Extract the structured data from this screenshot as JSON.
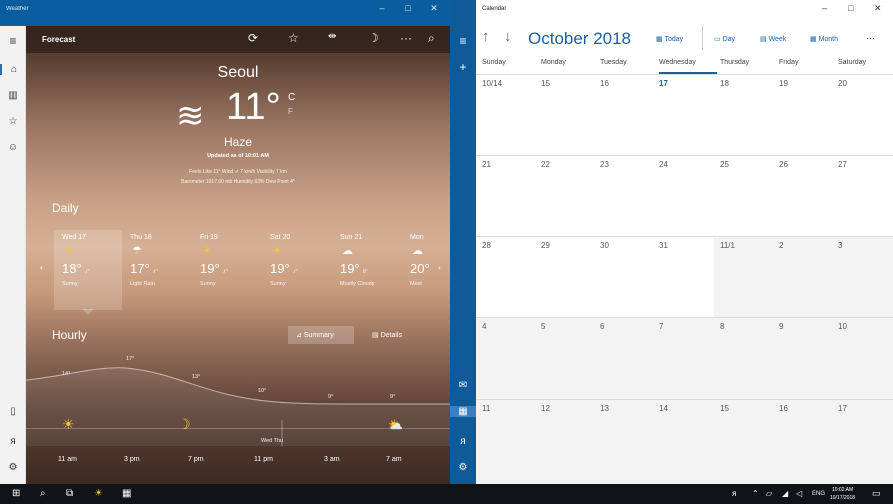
{
  "weather": {
    "window_title": "Weather",
    "topbar": {
      "title": "Forecast"
    },
    "city": "Seoul",
    "temperature": "11°",
    "unit_c": "C",
    "unit_f": "F",
    "condition": "Haze",
    "updated": "Updated as of 10:01 AM",
    "details_line1": "Feels Like 11°    Wind ➚ 7 km/h    Visibility 7 km",
    "details_line2": "Barometer 1017.00 mb    Humidity 63%    Dew Point 4°",
    "daily_label": "Daily",
    "days": [
      {
        "day": "Wed 17",
        "icon": "sun",
        "hi": "18°",
        "lo": "7°",
        "cond": "Sunny"
      },
      {
        "day": "Thu 18",
        "icon": "rain",
        "hi": "17°",
        "lo": "7°",
        "cond": "Light Rain"
      },
      {
        "day": "Fri 19",
        "icon": "sun",
        "hi": "19°",
        "lo": "7°",
        "cond": "Sunny"
      },
      {
        "day": "Sat 20",
        "icon": "sun",
        "hi": "19°",
        "lo": "7°",
        "cond": "Sunny"
      },
      {
        "day": "Sun 21",
        "icon": "cloud",
        "hi": "19°",
        "lo": "8°",
        "cond": "Mostly Cloudy"
      },
      {
        "day": "Mon",
        "icon": "cloud",
        "hi": "20°",
        "lo": "",
        "cond": "Most"
      }
    ],
    "hourly_label": "Hourly",
    "summary_label": "Summary",
    "details_label": "Details",
    "hourly_temps": [
      "14°",
      "17°",
      "13°",
      "10°",
      "9°",
      "9°"
    ],
    "hourly_times": [
      "11 am",
      "3 pm",
      "7 pm",
      "11 pm",
      "3 am",
      "7 am"
    ],
    "day_divider": "Wed   Thu"
  },
  "calendar": {
    "window_title": "Calendar",
    "month_title": "October 2018",
    "today_label": "Today",
    "day_label": "Day",
    "week_label": "Week",
    "month_label": "Month",
    "more_label": "···",
    "day_headers": [
      "Sunday",
      "Monday",
      "Tuesday",
      "Wednesday",
      "Thursday",
      "Friday",
      "Saturday"
    ],
    "weeks": [
      [
        "10/14",
        "15",
        "16",
        "17",
        "18",
        "19",
        "20"
      ],
      [
        "21",
        "22",
        "23",
        "24",
        "25",
        "26",
        "27"
      ],
      [
        "28",
        "29",
        "30",
        "31",
        "11/1",
        "2",
        "3"
      ],
      [
        "4",
        "5",
        "6",
        "7",
        "8",
        "9",
        "10"
      ],
      [
        "11",
        "12",
        "13",
        "14",
        "15",
        "16",
        "17"
      ]
    ]
  },
  "taskbar": {
    "lang": "ENG",
    "time": "10:02 AM",
    "date": "10/17/2018"
  }
}
